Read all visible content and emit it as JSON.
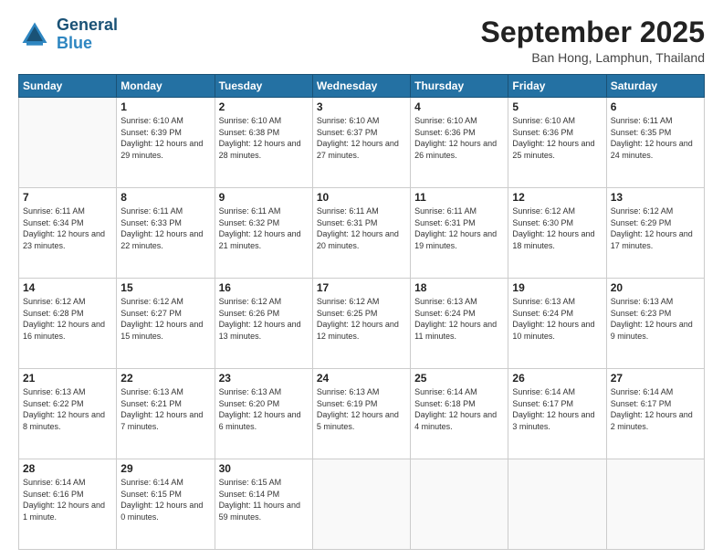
{
  "logo": {
    "line1": "General",
    "line2": "Blue"
  },
  "title": "September 2025",
  "location": "Ban Hong, Lamphun, Thailand",
  "weekdays": [
    "Sunday",
    "Monday",
    "Tuesday",
    "Wednesday",
    "Thursday",
    "Friday",
    "Saturday"
  ],
  "weeks": [
    [
      null,
      {
        "day": 1,
        "sunrise": "6:10 AM",
        "sunset": "6:39 PM",
        "daylight": "12 hours and 29 minutes."
      },
      {
        "day": 2,
        "sunrise": "6:10 AM",
        "sunset": "6:38 PM",
        "daylight": "12 hours and 28 minutes."
      },
      {
        "day": 3,
        "sunrise": "6:10 AM",
        "sunset": "6:37 PM",
        "daylight": "12 hours and 27 minutes."
      },
      {
        "day": 4,
        "sunrise": "6:10 AM",
        "sunset": "6:36 PM",
        "daylight": "12 hours and 26 minutes."
      },
      {
        "day": 5,
        "sunrise": "6:10 AM",
        "sunset": "6:36 PM",
        "daylight": "12 hours and 25 minutes."
      },
      {
        "day": 6,
        "sunrise": "6:11 AM",
        "sunset": "6:35 PM",
        "daylight": "12 hours and 24 minutes."
      }
    ],
    [
      {
        "day": 7,
        "sunrise": "6:11 AM",
        "sunset": "6:34 PM",
        "daylight": "12 hours and 23 minutes."
      },
      {
        "day": 8,
        "sunrise": "6:11 AM",
        "sunset": "6:33 PM",
        "daylight": "12 hours and 22 minutes."
      },
      {
        "day": 9,
        "sunrise": "6:11 AM",
        "sunset": "6:32 PM",
        "daylight": "12 hours and 21 minutes."
      },
      {
        "day": 10,
        "sunrise": "6:11 AM",
        "sunset": "6:31 PM",
        "daylight": "12 hours and 20 minutes."
      },
      {
        "day": 11,
        "sunrise": "6:11 AM",
        "sunset": "6:31 PM",
        "daylight": "12 hours and 19 minutes."
      },
      {
        "day": 12,
        "sunrise": "6:12 AM",
        "sunset": "6:30 PM",
        "daylight": "12 hours and 18 minutes."
      },
      {
        "day": 13,
        "sunrise": "6:12 AM",
        "sunset": "6:29 PM",
        "daylight": "12 hours and 17 minutes."
      }
    ],
    [
      {
        "day": 14,
        "sunrise": "6:12 AM",
        "sunset": "6:28 PM",
        "daylight": "12 hours and 16 minutes."
      },
      {
        "day": 15,
        "sunrise": "6:12 AM",
        "sunset": "6:27 PM",
        "daylight": "12 hours and 15 minutes."
      },
      {
        "day": 16,
        "sunrise": "6:12 AM",
        "sunset": "6:26 PM",
        "daylight": "12 hours and 13 minutes."
      },
      {
        "day": 17,
        "sunrise": "6:12 AM",
        "sunset": "6:25 PM",
        "daylight": "12 hours and 12 minutes."
      },
      {
        "day": 18,
        "sunrise": "6:13 AM",
        "sunset": "6:24 PM",
        "daylight": "12 hours and 11 minutes."
      },
      {
        "day": 19,
        "sunrise": "6:13 AM",
        "sunset": "6:24 PM",
        "daylight": "12 hours and 10 minutes."
      },
      {
        "day": 20,
        "sunrise": "6:13 AM",
        "sunset": "6:23 PM",
        "daylight": "12 hours and 9 minutes."
      }
    ],
    [
      {
        "day": 21,
        "sunrise": "6:13 AM",
        "sunset": "6:22 PM",
        "daylight": "12 hours and 8 minutes."
      },
      {
        "day": 22,
        "sunrise": "6:13 AM",
        "sunset": "6:21 PM",
        "daylight": "12 hours and 7 minutes."
      },
      {
        "day": 23,
        "sunrise": "6:13 AM",
        "sunset": "6:20 PM",
        "daylight": "12 hours and 6 minutes."
      },
      {
        "day": 24,
        "sunrise": "6:13 AM",
        "sunset": "6:19 PM",
        "daylight": "12 hours and 5 minutes."
      },
      {
        "day": 25,
        "sunrise": "6:14 AM",
        "sunset": "6:18 PM",
        "daylight": "12 hours and 4 minutes."
      },
      {
        "day": 26,
        "sunrise": "6:14 AM",
        "sunset": "6:17 PM",
        "daylight": "12 hours and 3 minutes."
      },
      {
        "day": 27,
        "sunrise": "6:14 AM",
        "sunset": "6:17 PM",
        "daylight": "12 hours and 2 minutes."
      }
    ],
    [
      {
        "day": 28,
        "sunrise": "6:14 AM",
        "sunset": "6:16 PM",
        "daylight": "12 hours and 1 minute."
      },
      {
        "day": 29,
        "sunrise": "6:14 AM",
        "sunset": "6:15 PM",
        "daylight": "12 hours and 0 minutes."
      },
      {
        "day": 30,
        "sunrise": "6:15 AM",
        "sunset": "6:14 PM",
        "daylight": "11 hours and 59 minutes."
      },
      null,
      null,
      null,
      null
    ]
  ]
}
